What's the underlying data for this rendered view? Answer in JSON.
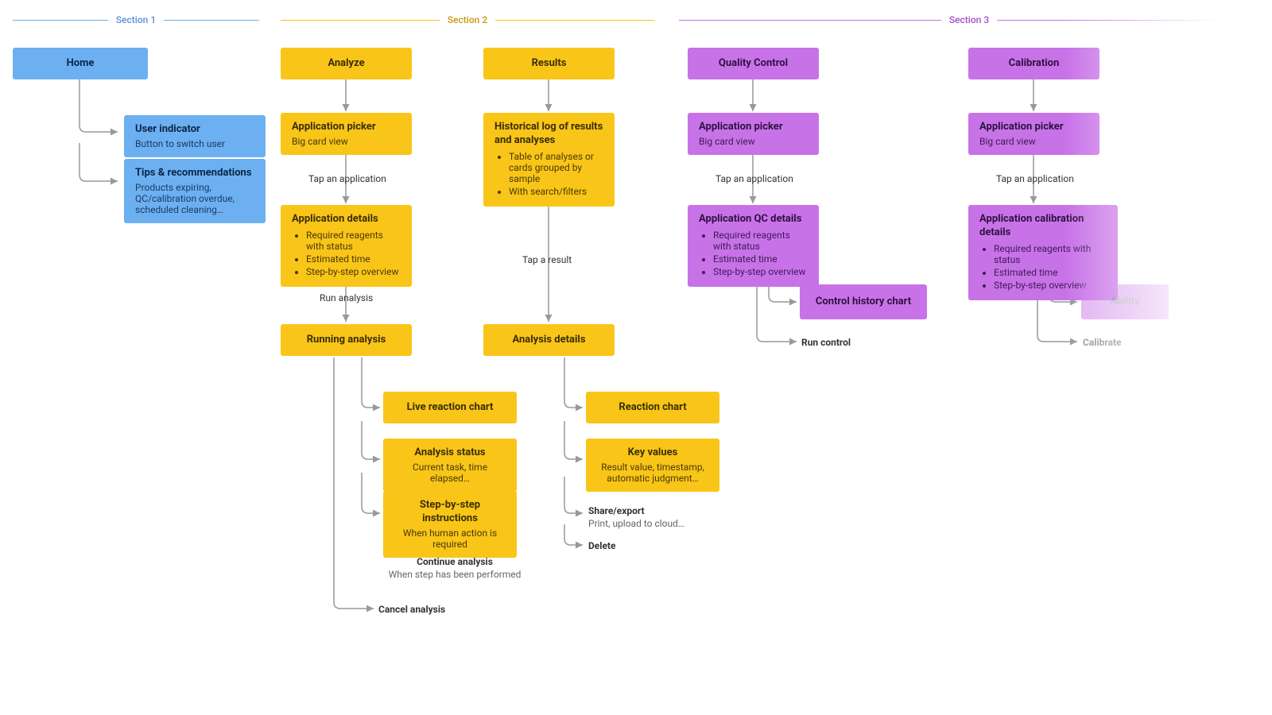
{
  "sections": {
    "s1": {
      "label": "Section 1",
      "color": "#6CB0F2"
    },
    "s2": {
      "label": "Section 2",
      "color": "#F9C518"
    },
    "s3": {
      "label": "Section 3",
      "color": "#C872E8"
    }
  },
  "nodes": {
    "home": {
      "title": "Home"
    },
    "user_ind": {
      "title": "User indicator",
      "sub": "Button to switch user"
    },
    "tips": {
      "title": "Tips & recommendations",
      "sub": "Products expiring, QC/calibration overdue, scheduled cleaning…"
    },
    "analyze": {
      "title": "Analyze"
    },
    "app_picker_a": {
      "title": "Application picker",
      "sub": "Big card view"
    },
    "tap_app_a": {
      "label": "Tap an application"
    },
    "app_details": {
      "title": "Application details",
      "items": [
        "Required reagents with status",
        "Estimated time",
        "Step-by-step overview"
      ]
    },
    "run_analysis": {
      "label": "Run analysis"
    },
    "running": {
      "title": "Running analysis"
    },
    "live_chart": {
      "title": "Live reaction chart"
    },
    "an_status": {
      "title": "Analysis status",
      "sub": "Current task, time elapsed…"
    },
    "step_instr": {
      "title": "Step-by-step instructions",
      "sub": "When human action is required"
    },
    "cont_analysis": {
      "title": "Continue analysis",
      "sub": "When step has been performed"
    },
    "cancel": {
      "title": "Cancel analysis"
    },
    "results": {
      "title": "Results"
    },
    "hist_log": {
      "title": "Historical log of results and analyses",
      "items": [
        "Table of analyses or cards grouped by sample",
        "With search/filters"
      ]
    },
    "tap_result": {
      "label": "Tap a result"
    },
    "an_details": {
      "title": "Analysis details"
    },
    "react_chart": {
      "title": "Reaction chart"
    },
    "key_values": {
      "title": "Key values",
      "sub": "Result value, timestamp, automatic judgment…"
    },
    "share": {
      "title": "Share/export",
      "sub": "Print, upload to cloud…"
    },
    "delete": {
      "title": "Delete"
    },
    "qc": {
      "title": "Quality Control"
    },
    "app_picker_q": {
      "title": "Application picker",
      "sub": "Big card view"
    },
    "tap_app_q": {
      "label": "Tap an application"
    },
    "qc_details": {
      "title": "Application QC details",
      "items": [
        "Required reagents with status",
        "Estimated time",
        "Step-by-step overview"
      ]
    },
    "ctrl_hist": {
      "title": "Control history chart"
    },
    "run_control": {
      "title": "Run control"
    },
    "calibration": {
      "title": "Calibration"
    },
    "app_picker_c": {
      "title": "Application picker",
      "sub": "Big card view"
    },
    "tap_app_c": {
      "label": "Tap an application"
    },
    "cal_details": {
      "title": "Application calibration details",
      "items": [
        "Required reagents with status",
        "Estimated time",
        "Step-by-step overview"
      ]
    },
    "ability": {
      "title": "Ability"
    },
    "calibrate": {
      "title": "Calibrate"
    }
  }
}
